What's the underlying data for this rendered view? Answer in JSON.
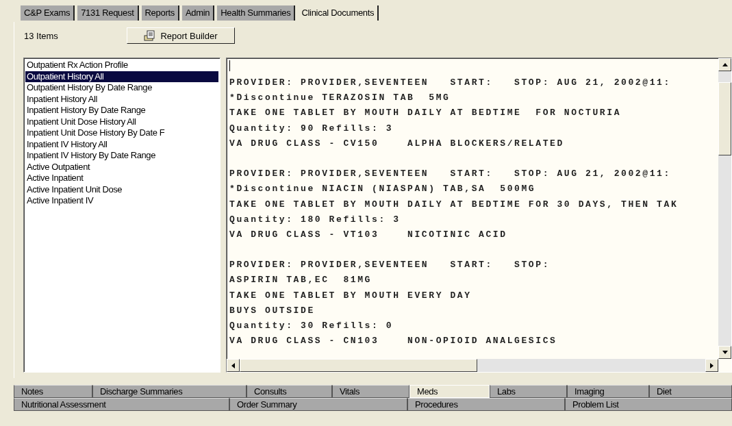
{
  "top_tabs": [
    {
      "label": "C&P Exams",
      "selected": false
    },
    {
      "label": "7131 Request",
      "selected": false
    },
    {
      "label": "Reports",
      "selected": false
    },
    {
      "label": "Admin",
      "selected": false
    },
    {
      "label": "Health Summaries",
      "selected": false
    },
    {
      "label": "Clinical Documents",
      "selected": true
    }
  ],
  "toolbar": {
    "item_count": "13 Items",
    "button": "Report Builder"
  },
  "report_list": [
    {
      "label": "Outpatient Rx Action Profile",
      "selected": false
    },
    {
      "label": "Outpatient History All",
      "selected": true
    },
    {
      "label": "Outpatient History By Date Range",
      "selected": false
    },
    {
      "label": "Inpatient History All",
      "selected": false
    },
    {
      "label": "Inpatient History By Date Range",
      "selected": false
    },
    {
      "label": "Inpatient Unit Dose History All",
      "selected": false
    },
    {
      "label": "Inpatient Unit Dose History By Date F",
      "selected": false
    },
    {
      "label": "Inpatient IV History All",
      "selected": false
    },
    {
      "label": "Inpatient IV History By Date Range",
      "selected": false
    },
    {
      "label": "Active Outpatient",
      "selected": false
    },
    {
      "label": "Active Inpatient",
      "selected": false
    },
    {
      "label": "Active Inpatient Unit Dose",
      "selected": false
    },
    {
      "label": "Active Inpatient IV",
      "selected": false
    }
  ],
  "report_text": [
    {
      "lines": [
        "PROVIDER: PROVIDER,SEVENTEEN   START:   STOP: AUG 21, 2002@11:",
        "*Discontinue TERAZOSIN TAB  5MG",
        "TAKE ONE TABLET BY MOUTH DAILY AT BEDTIME  FOR NOCTURIA",
        "Quantity: 90 Refills: 3",
        "VA DRUG CLASS - CV150    ALPHA BLOCKERS/RELATED"
      ]
    },
    {
      "lines": [
        "PROVIDER: PROVIDER,SEVENTEEN   START:   STOP: AUG 21, 2002@11:",
        "*Discontinue NIACIN (NIASPAN) TAB,SA  500MG",
        "TAKE ONE TABLET BY MOUTH DAILY AT BEDTIME FOR 30 DAYS, THEN TAK",
        "Quantity: 180 Refills: 3",
        "VA DRUG CLASS - VT103    NICOTINIC ACID"
      ]
    },
    {
      "lines": [
        "PROVIDER: PROVIDER,SEVENTEEN   START:   STOP:",
        "ASPIRIN TAB,EC  81MG",
        "TAKE ONE TABLET BY MOUTH EVERY DAY",
        "BUYS OUTSIDE",
        "Quantity: 30 Refills: 0",
        "VA DRUG CLASS - CN103    NON-OPIOID ANALGESICS"
      ]
    }
  ],
  "bottom_tabs": [
    [
      {
        "label": "Notes",
        "selected": false
      },
      {
        "label": "Discharge Summaries",
        "selected": false
      },
      {
        "label": "Consults",
        "selected": false
      },
      {
        "label": "Vitals",
        "selected": false
      },
      {
        "label": "Meds",
        "selected": true
      },
      {
        "label": "Labs",
        "selected": false
      },
      {
        "label": "Imaging",
        "selected": false
      },
      {
        "label": "Diet",
        "selected": false
      }
    ],
    [
      {
        "label": "Nutritional Assessment",
        "selected": false
      },
      {
        "label": "Order Summary",
        "selected": false
      },
      {
        "label": "Procedures",
        "selected": false
      },
      {
        "label": "Problem List",
        "selected": false
      }
    ]
  ]
}
